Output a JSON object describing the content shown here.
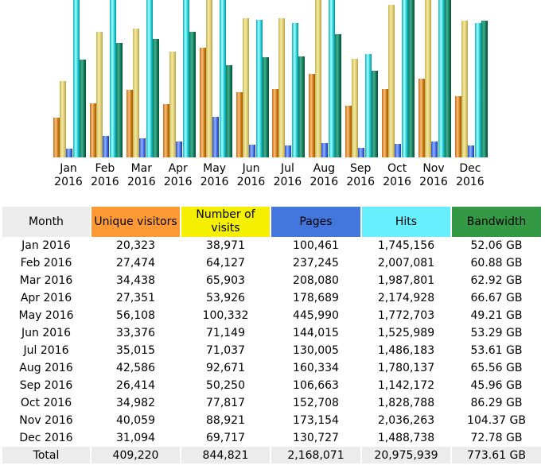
{
  "colors": {
    "unique": "#ff9933",
    "visits": "#f4f000",
    "pages": "#4477dd",
    "hits": "#66f0ff",
    "bandwidth": "#339944",
    "header": "#ececec"
  },
  "headers": [
    "Month",
    "Unique visitors",
    "Number of visits",
    "Pages",
    "Hits",
    "Bandwidth"
  ],
  "rows": [
    [
      "Jan 2016",
      "20,323",
      "38,971",
      "100,461",
      "1,745,156",
      "52.06 GB"
    ],
    [
      "Feb 2016",
      "27,474",
      "64,127",
      "237,245",
      "2,007,081",
      "60.88 GB"
    ],
    [
      "Mar 2016",
      "34,438",
      "65,903",
      "208,080",
      "1,987,801",
      "62.92 GB"
    ],
    [
      "Apr 2016",
      "27,351",
      "53,926",
      "178,689",
      "2,174,928",
      "66.67 GB"
    ],
    [
      "May 2016",
      "56,108",
      "100,332",
      "445,990",
      "1,772,703",
      "49.21 GB"
    ],
    [
      "Jun 2016",
      "33,376",
      "71,149",
      "144,015",
      "1,525,989",
      "53.29 GB"
    ],
    [
      "Jul 2016",
      "35,015",
      "71,037",
      "130,005",
      "1,486,183",
      "53.61 GB"
    ],
    [
      "Aug 2016",
      "42,586",
      "92,671",
      "160,334",
      "1,780,137",
      "65.56 GB"
    ],
    [
      "Sep 2016",
      "26,414",
      "50,250",
      "106,663",
      "1,142,172",
      "45.96 GB"
    ],
    [
      "Oct 2016",
      "34,982",
      "77,817",
      "152,708",
      "1,828,788",
      "86.29 GB"
    ],
    [
      "Nov 2016",
      "40,059",
      "88,921",
      "173,154",
      "2,036,263",
      "104.37 GB"
    ],
    [
      "Dec 2016",
      "31,094",
      "69,717",
      "130,727",
      "1,488,738",
      "72.78 GB"
    ]
  ],
  "total": [
    "Total",
    "409,220",
    "844,821",
    "2,168,071",
    "20,975,939",
    "773.61 GB"
  ],
  "chart_data": {
    "type": "bar",
    "categories": [
      [
        "Jan",
        "2016"
      ],
      [
        "Feb",
        "2016"
      ],
      [
        "Mar",
        "2016"
      ],
      [
        "Apr",
        "2016"
      ],
      [
        "May",
        "2016"
      ],
      [
        "Jun",
        "2016"
      ],
      [
        "Jul",
        "2016"
      ],
      [
        "Aug",
        "2016"
      ],
      [
        "Sep",
        "2016"
      ],
      [
        "Oct",
        "2016"
      ],
      [
        "Nov",
        "2016"
      ],
      [
        "Dec",
        "2016"
      ]
    ],
    "series": [
      {
        "key": "unique",
        "values": [
          20323,
          27474,
          34438,
          27351,
          56108,
          33376,
          35015,
          42586,
          26414,
          34982,
          40059,
          31094
        ]
      },
      {
        "key": "visits",
        "values": [
          38971,
          64127,
          65903,
          53926,
          100332,
          71149,
          71037,
          92671,
          50250,
          77817,
          88921,
          69717
        ]
      },
      {
        "key": "pages",
        "values": [
          100461,
          237245,
          208080,
          178689,
          445990,
          144015,
          130005,
          160334,
          106663,
          152708,
          173154,
          130727
        ]
      },
      {
        "key": "hits",
        "values": [
          1745156,
          2007081,
          1987801,
          2174928,
          1772703,
          1525989,
          1486183,
          1780137,
          1142172,
          1828788,
          2036263,
          1488738
        ]
      },
      {
        "key": "bandwidth",
        "values": [
          52.06,
          60.88,
          62.92,
          66.67,
          49.21,
          53.29,
          53.61,
          65.56,
          45.96,
          86.29,
          104.37,
          72.78
        ]
      }
    ]
  }
}
